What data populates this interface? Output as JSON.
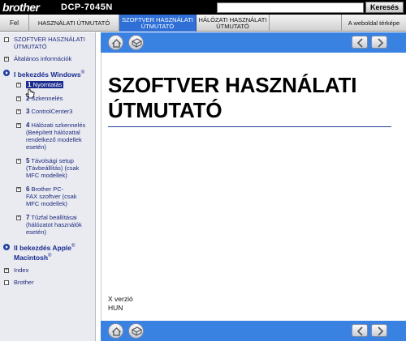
{
  "header": {
    "logo": "brother",
    "model": "DCP-7045N",
    "search_placeholder": "",
    "search_button": "Keresés"
  },
  "tabs": {
    "up": "Fel",
    "user_guide": "HASZNÁLATI ÚTMUTATÓ",
    "software_line1": "SZOFTVER HASZNÁLATI",
    "software_line2": "ÚTMUTATÓ",
    "network_line1": "HÁLÓZATI HASZNÁLATI",
    "network_line2": "ÚTMUTATÓ",
    "website": "A weboldal térképe"
  },
  "sidebar": {
    "root_line1": "SZOFTVER HASZNÁLATI",
    "root_line2": "ÚTMUTATÓ",
    "general": "Általános információk",
    "section1_title": "I bekezdés Windows",
    "section1_sup": "®",
    "items": [
      {
        "num": "1",
        "lines": [
          "Nyomtatás"
        ]
      },
      {
        "num": "2",
        "lines": [
          "Szkennelés"
        ]
      },
      {
        "num": "3",
        "lines": [
          "ControlCenter3"
        ]
      },
      {
        "num": "4",
        "lines": [
          "Hálózati szkennelés",
          "(Beépített hálózattal",
          "rendelkező modellek",
          "esetén)"
        ]
      },
      {
        "num": "5",
        "lines": [
          "Távolsági setup",
          "(Távbeállítás) (csak",
          "MFC modellek)"
        ]
      },
      {
        "num": "6",
        "lines": [
          "Brother PC-",
          "FAX szoftver (csak",
          "MFC modellek)"
        ]
      },
      {
        "num": "7",
        "lines": [
          "Tűzfal beállításai",
          "(hálózatot használók",
          "esetén)"
        ]
      }
    ],
    "section2_line1": "II bekezdés Apple",
    "section2_sup1": "®",
    "section2_line2": "Macintosh",
    "section2_sup2": "®",
    "index": "Index",
    "brother": "Brother"
  },
  "main": {
    "title_line1": "SZOFTVER HASZNÁLATI",
    "title_line2": "ÚTMUTATÓ",
    "version": "X verzió",
    "language": "HUN"
  },
  "icons": {
    "home": "home-icon",
    "toc": "book-icon",
    "prev": "arrow-left-icon",
    "next": "arrow-right-icon"
  },
  "colors": {
    "accent_blue": "#3a82e2",
    "tab_active": "#2f6fd6",
    "link_navy": "#1e2a7e",
    "rule": "#1f3f9a"
  }
}
